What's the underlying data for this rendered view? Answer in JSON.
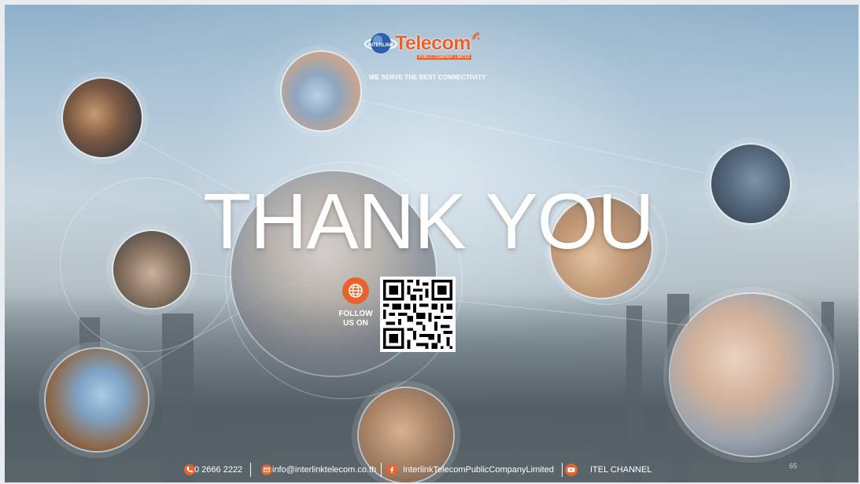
{
  "brand": {
    "logo_small": "INTERLINK",
    "logo_word": "Telecom",
    "logo_sub": "PUBLIC COMPANY LIMITED",
    "tagline": "WE SERVE THE BEST CONNECTIVITY",
    "accent_color": "#e8632b"
  },
  "slide": {
    "title": "THANK YOU",
    "follow_label_line1": "FOLLOW",
    "follow_label_line2": "US ON",
    "page_number": "65"
  },
  "footer": {
    "phone": "0 2666 2222",
    "email": "info@interlinktelecom.co.th",
    "facebook": "InterlinkTelecomPublicCompanyLimited",
    "youtube": "ITEL CHANNEL"
  },
  "icons": [
    "globe-icon",
    "phone-icon",
    "email-icon",
    "facebook-icon",
    "youtube-icon",
    "qr-code"
  ]
}
